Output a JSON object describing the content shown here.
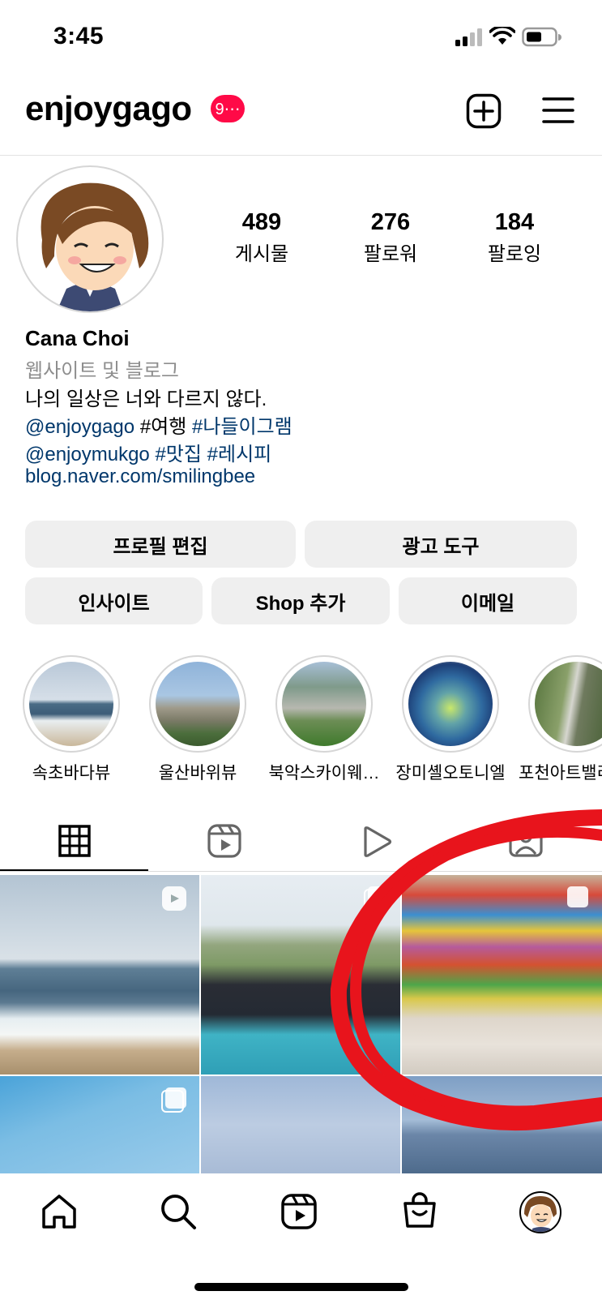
{
  "status_bar": {
    "time": "3:45"
  },
  "header": {
    "username": "enjoygago",
    "notification_badge": "9⋯"
  },
  "profile": {
    "stats": [
      {
        "value": "489",
        "label": "게시물"
      },
      {
        "value": "276",
        "label": "팔로워"
      },
      {
        "value": "184",
        "label": "팔로잉"
      }
    ],
    "name": "Cana Choi",
    "category": "웹사이트 및 블로그",
    "bio_text": "나의 일상은 너와 다르지 않다.",
    "bio_line2": {
      "mention": "@enjoygago",
      "tag1": "#여행",
      "tag2": "#나들이그램"
    },
    "bio_line3": {
      "mention": "@enjoymukgo",
      "tag1": "#맛집",
      "tag2": "#레시피"
    },
    "website": "blog.naver.com/smilingbee"
  },
  "buttons": {
    "edit_profile": "프로필 편집",
    "ad_tools": "광고 도구",
    "insights": "인사이트",
    "add_shop": "Shop 추가",
    "email": "이메일"
  },
  "highlights": [
    {
      "label": "속초바다뷰"
    },
    {
      "label": "울산바위뷰"
    },
    {
      "label": "북악스카이웨…"
    },
    {
      "label": "장미셸오토니엘"
    },
    {
      "label": "포천아트밸리"
    }
  ],
  "tabs": [
    "grid-icon",
    "reels-icon",
    "video-play-icon",
    "tagged-icon"
  ],
  "nav": [
    "home-icon",
    "search-icon",
    "reels-icon",
    "shop-icon",
    "profile-avatar"
  ],
  "colors": {
    "badge": "#ff0a47",
    "link": "#00376b",
    "button_bg": "#efefef",
    "annotation": "#e8141c"
  }
}
